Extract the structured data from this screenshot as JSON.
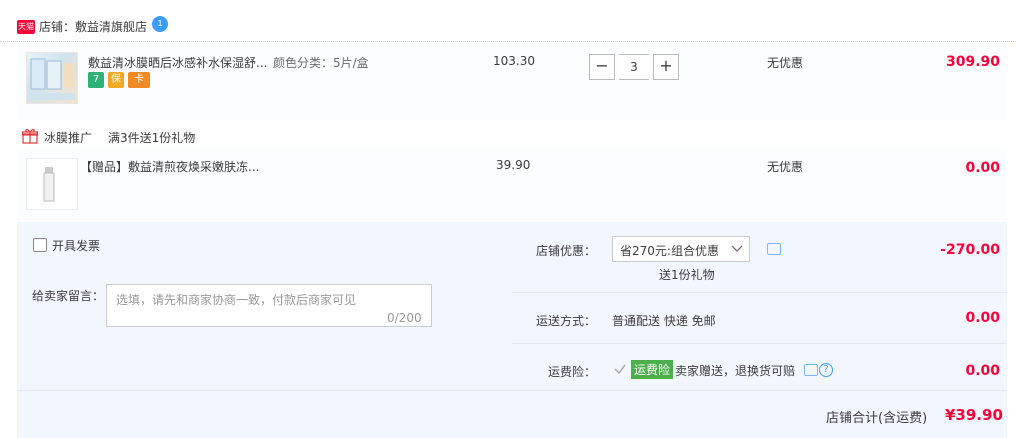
{
  "store": {
    "badge": "天猫",
    "name": "店铺：敷益清旗舰店",
    "ww_count": "1"
  },
  "item": {
    "title": "敷益清冰膜晒后冰感补水保湿舒...",
    "sku": "颜色分类：5片/盒",
    "price": "103.30",
    "quantity": "3",
    "minus": "−",
    "plus": "+",
    "discount": "无优惠",
    "subtotal": "309.90",
    "services": [
      "7",
      "保",
      "卡"
    ]
  },
  "promotion": {
    "name": "冰膜推广",
    "rule": "满3件送1份礼物"
  },
  "gift": {
    "title": "【赠品】敷益清煎夜焕采嫩肤冻...",
    "price": "39.90",
    "discount": "无优惠",
    "subtotal": "0.00"
  },
  "invoice": {
    "label": "开具发票"
  },
  "message": {
    "label": "给卖家留言：",
    "placeholder": "选填，请先和商家协商一致，付款后商家可见",
    "counter": "0/200"
  },
  "store_discount": {
    "label": "店铺优惠：",
    "selected": "省270元:组合优惠",
    "note": "送1份礼物",
    "amount": "-270.00"
  },
  "shipping": {
    "label": "运送方式：",
    "method": "普通配送 快递 免邮",
    "amount": "0.00"
  },
  "insurance": {
    "label": "运费险：",
    "tag": "运费险",
    "desc": "卖家赠送，退换货可赔",
    "amount": "0.00"
  },
  "total": {
    "label": "店铺合计(含运费)",
    "amount": "¥39.90"
  },
  "colors": {
    "accent_red": "#ff0036",
    "tmall_red": "#ff0036",
    "insurance_green": "#4bb04b",
    "link_blue": "#3b9cff"
  }
}
